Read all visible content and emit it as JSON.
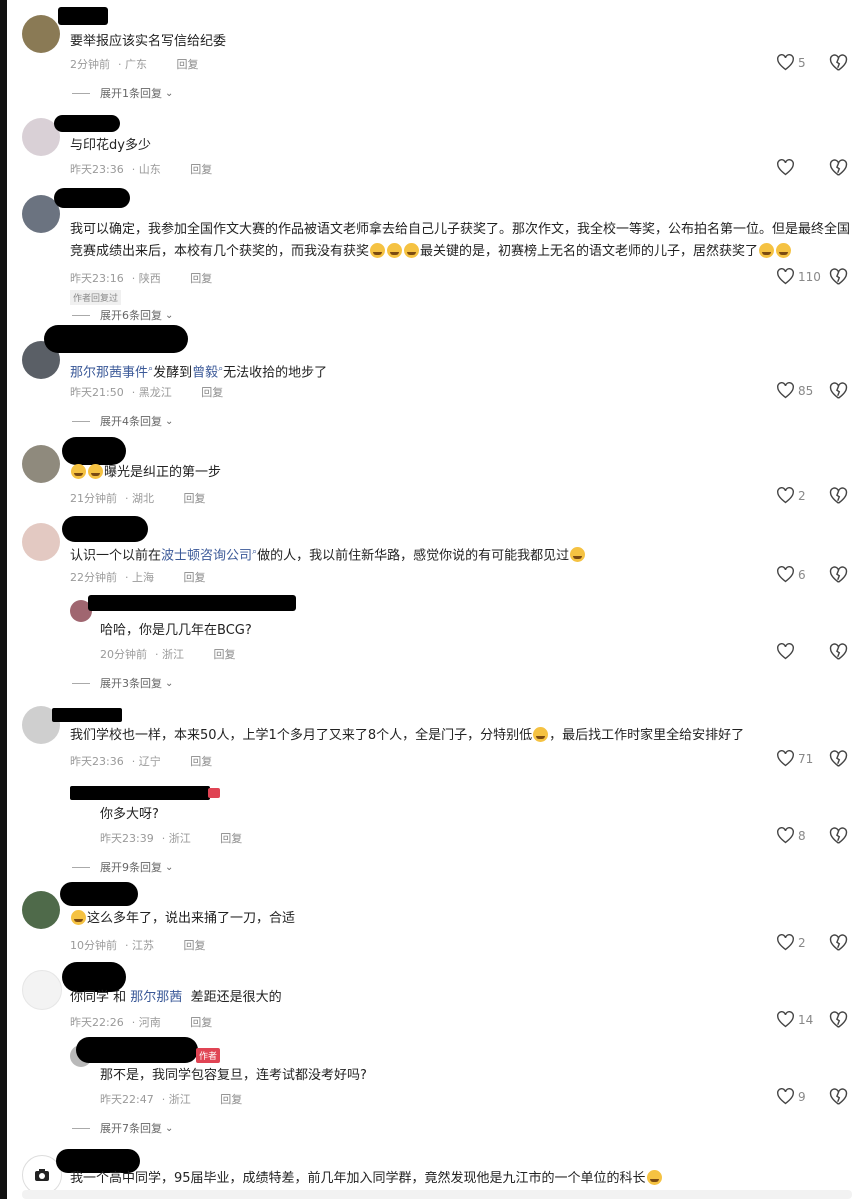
{
  "comments": [
    {
      "text": "要举报应该实名写信给纪委",
      "time": "2分钟前",
      "location": "广东",
      "reply_label": "回复",
      "likes": "5",
      "expand": "展开1条回复"
    },
    {
      "text": "与印花dy多少",
      "time": "昨天23:36",
      "location": "山东",
      "reply_label": "回复",
      "likes": ""
    },
    {
      "text": "我可以确定，我参加全国作文大赛的作品被语文老师拿去给自己儿子获奖了。那次作文，我全校一等奖，公布拍名第一位。但是最终全国竞赛成绩出来后，本校有几个获奖的，而我没有获奖",
      "text_tail_1": "最关键的是，初赛榜上无名的语文老师的儿子，居然获奖了",
      "time": "昨天23:16",
      "location": "陕西",
      "reply_label": "回复",
      "likes": "110",
      "tag": "作者回复过",
      "expand": "展开6条回复"
    },
    {
      "link_1": "那尔那茜事件",
      "text_mid": "发酵到",
      "link_2": "曾毅",
      "text_tail": "无法收拾的地步了",
      "time": "昨天21:50",
      "location": "黑龙江",
      "reply_label": "回复",
      "likes": "85",
      "expand": "展开4条回复"
    },
    {
      "text": "曝光是纠正的第一步",
      "time": "21分钟前",
      "location": "湖北",
      "reply_label": "回复",
      "likes": "2"
    },
    {
      "text_head": "认识一个以前在",
      "link_1": "波士顿咨询公司",
      "text_tail": "做的人，我以前住新华路，感觉你说的有可能我都见过",
      "time": "22分钟前",
      "location": "上海",
      "reply_label": "回复",
      "likes": "6",
      "reply": {
        "text": "哈哈，你是几几年在BCG?",
        "time": "20分钟前",
        "location": "浙江",
        "reply_label": "回复",
        "likes": ""
      },
      "expand": "展开3条回复"
    },
    {
      "text_head": "我们学校也一样，本来50人，上学1个多月了又来了8个人，全是门子，分特别低",
      "text_tail": "，最后找工作时家里全给安排好了",
      "time": "昨天23:36",
      "location": "辽宁",
      "reply_label": "回复",
      "likes": "71",
      "reply": {
        "text": "你多大呀?",
        "time": "昨天23:39",
        "location": "浙江",
        "reply_label": "回复",
        "likes": "8"
      },
      "expand": "展开9条回复"
    },
    {
      "text": "这么多年了，说出来捅了一刀，合适",
      "time": "10分钟前",
      "location": "江苏",
      "reply_label": "回复",
      "likes": "2"
    },
    {
      "text_head": "你同学 和",
      "link_1": "那尔那茜",
      "text_tail": "差距还是很大的",
      "time": "昨天22:26",
      "location": "河南",
      "reply_label": "回复",
      "likes": "14",
      "reply": {
        "badge": "作者",
        "text": "那不是，我同学包容复旦，连考试都没考好吗?",
        "time": "昨天22:47",
        "location": "浙江",
        "reply_label": "回复",
        "likes": "9"
      },
      "expand": "展开7条回复"
    },
    {
      "text": "我一个高中同学，95届毕业，成绩特差，前几年加入同学群，竟然发现他是九江市的一个单位的科长"
    }
  ]
}
